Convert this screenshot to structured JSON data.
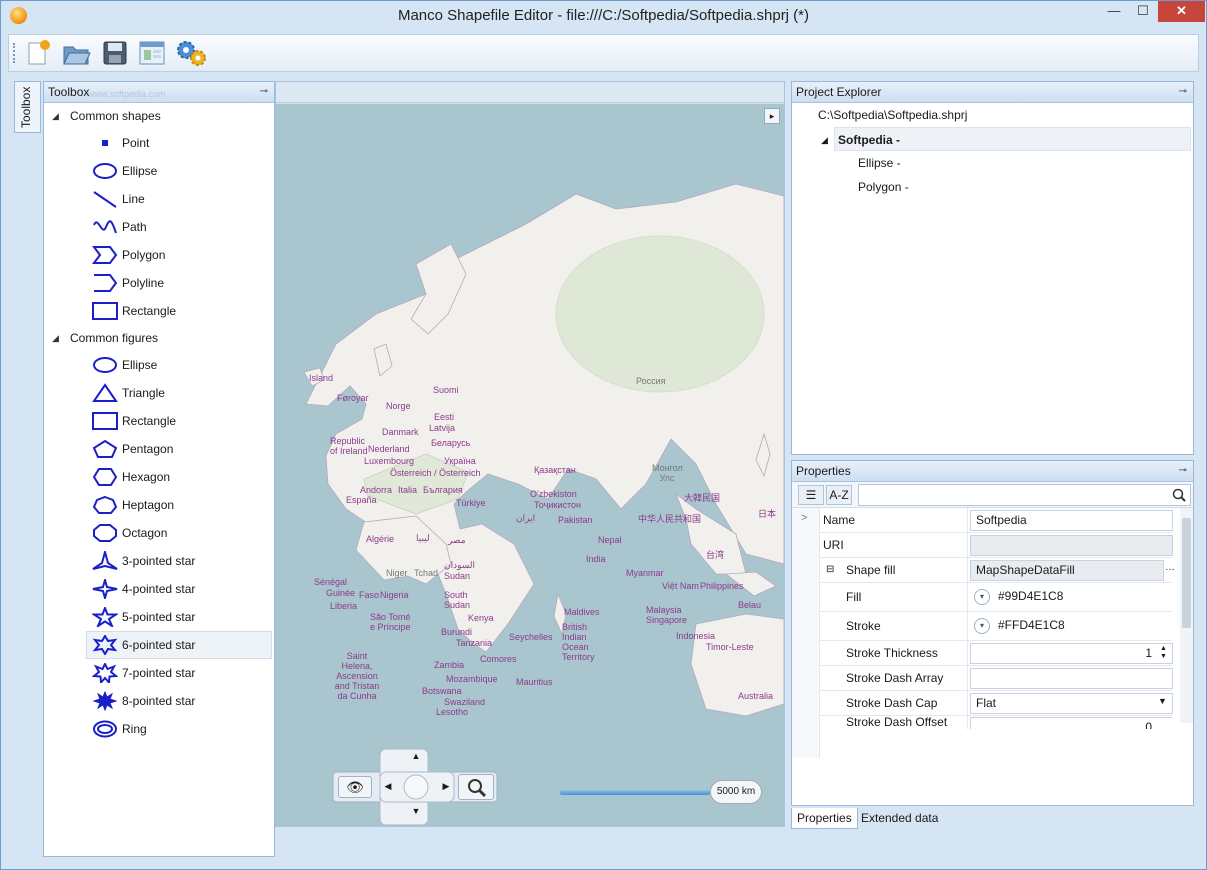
{
  "window": {
    "title": "Manco Shapefile Editor - file:///C:/Softpedia/Softpedia.shprj (*)",
    "min_label": "—",
    "max_label": "☐",
    "close_label": "✕"
  },
  "toolbar": {
    "buttons": [
      "new-icon",
      "open-icon",
      "save-icon",
      "map-settings-icon",
      "settings-icon"
    ]
  },
  "side_tab": {
    "label": "Toolbox"
  },
  "toolbox": {
    "title": "Toolbox",
    "watermark": "www.softpedia.com",
    "groups": [
      {
        "label": "Common shapes",
        "items": [
          "Point",
          "Ellipse",
          "Line",
          "Path",
          "Polygon",
          "Polyline",
          "Rectangle"
        ]
      },
      {
        "label": "Common figures",
        "items": [
          "Ellipse",
          "Triangle",
          "Rectangle",
          "Pentagon",
          "Hexagon",
          "Heptagon",
          "Octagon",
          "3-pointed star",
          "4-pointed star",
          "5-pointed star",
          "6-pointed star",
          "7-pointed star",
          "8-pointed star",
          "Ring"
        ]
      }
    ],
    "selected_item": "6-pointed star"
  },
  "map": {
    "labels": [
      "Island",
      "Føroyar",
      "Norge",
      "Suomi",
      "Eesti",
      "Latvija",
      "Danmark",
      "Беларусь",
      "Republic of Ireland",
      "Nederland",
      "Luxembourg",
      "Україна",
      "Österreich / Österreich",
      "Andorra",
      "Italia",
      "България",
      "España",
      "Türkiye",
      "Қазақстан",
      "O'zbekiston",
      "Тоҷикистон",
      "Pakistan",
      "Nepal",
      "India",
      "Россия",
      "Монгол Улс",
      "中华人民共和国",
      "大韓民国",
      "日本",
      "台湾",
      "Myanmar",
      "Việt Nam",
      "Philippines",
      "Malaysia",
      "Singapore",
      "Indonesia",
      "Timor-Leste",
      "Australia",
      "Belau",
      "Algérie",
      "Niger",
      "Tchad",
      "Sénégal",
      "Guinée",
      "Faso",
      "Liberia",
      "Nigeria",
      "São Tomé e Príncipe",
      "South Sudan",
      "Kenya",
      "Burundi",
      "Tanzania",
      "Zambia",
      "Comores",
      "Seychelles",
      "Maldives",
      "British Indian Ocean Territory",
      "Mozambique",
      "Botswana",
      "Swaziland",
      "Lesotho",
      "Mauritius",
      "Saint Helena, Ascension and Tristan da Cunha",
      "Sudan",
      "السودان",
      "ليبيا",
      "مصر",
      "ایران"
    ],
    "scale": "5000 km"
  },
  "explorer": {
    "title": "Project Explorer",
    "root": "C:\\Softpedia\\Softpedia.shprj",
    "layer": "Softpedia -",
    "children": [
      "Ellipse -",
      "Polygon -"
    ]
  },
  "properties": {
    "title": "Properties",
    "sort_alpha": "A-Z",
    "rows": [
      {
        "name": "Name",
        "value": "Softpedia"
      },
      {
        "name": "URI",
        "value": ""
      },
      {
        "name": "Shape fill",
        "value": "MapShapeDataFill"
      },
      {
        "name": "Fill",
        "value": "#99D4E1C8"
      },
      {
        "name": "Stroke",
        "value": "#FFD4E1C8"
      },
      {
        "name": "Stroke Thickness",
        "value": "1"
      },
      {
        "name": "Stroke Dash Array",
        "value": ""
      },
      {
        "name": "Stroke Dash Cap",
        "value": "Flat"
      },
      {
        "name": "Stroke Dash Offset",
        "value": "0"
      }
    ],
    "tabs": [
      "Properties",
      "Extended data"
    ]
  }
}
